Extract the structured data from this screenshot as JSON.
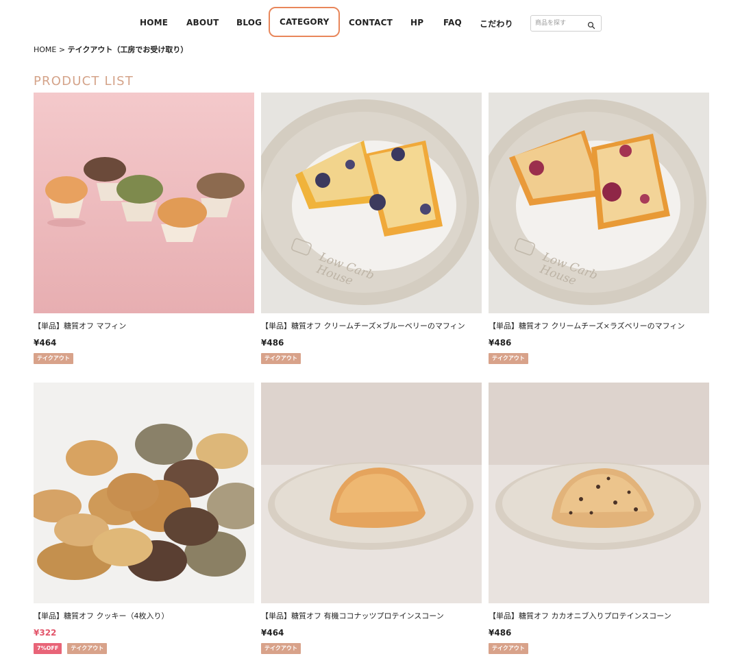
{
  "nav": {
    "items": [
      {
        "label": "HOME"
      },
      {
        "label": "ABOUT"
      },
      {
        "label": "BLOG"
      },
      {
        "label": "CATEGORY"
      },
      {
        "label": "CONTACT"
      },
      {
        "label": "HP"
      },
      {
        "label": "FAQ"
      },
      {
        "label": "こだわり"
      }
    ],
    "active_item": "CATEGORY",
    "search": {
      "placeholder": "商品を探す",
      "value": "",
      "icon": "search-icon"
    }
  },
  "breadcrumb": {
    "home": "HOME",
    "separator": ">",
    "current": "テイクアウト（工房でお受け取り）"
  },
  "page_title": "PRODUCT LIST",
  "colors": {
    "accent": "#e8865a",
    "title": "#d4a389",
    "badge": "#d8a28a",
    "discount_badge": "#e86478",
    "sale_price": "#e2556a"
  },
  "products": [
    {
      "name": "【単品】糖質オフ マフィン",
      "price": "¥464",
      "sale": false,
      "badges": [
        "テイクアウト"
      ]
    },
    {
      "name": "【単品】糖質オフ クリームチーズ×ブルーベリーのマフィン",
      "price": "¥486",
      "sale": false,
      "badges": [
        "テイクアウト"
      ]
    },
    {
      "name": "【単品】糖質オフ クリームチーズ×ラズベリーのマフィン",
      "price": "¥486",
      "sale": false,
      "badges": [
        "テイクアウト"
      ]
    },
    {
      "name": "【単品】糖質オフ クッキー（4枚入り）",
      "price": "¥322",
      "sale": true,
      "badges": [
        "7%OFF",
        "テイクアウト"
      ]
    },
    {
      "name": "【単品】糖質オフ 有機ココナッツプロテインスコーン",
      "price": "¥464",
      "sale": false,
      "badges": [
        "テイクアウト"
      ]
    },
    {
      "name": "【単品】糖質オフ カカオニブ入りプロテインスコーン",
      "price": "¥486",
      "sale": false,
      "badges": [
        "テイクアウト"
      ]
    }
  ],
  "plate_text": [
    "Low Carb",
    "House"
  ]
}
